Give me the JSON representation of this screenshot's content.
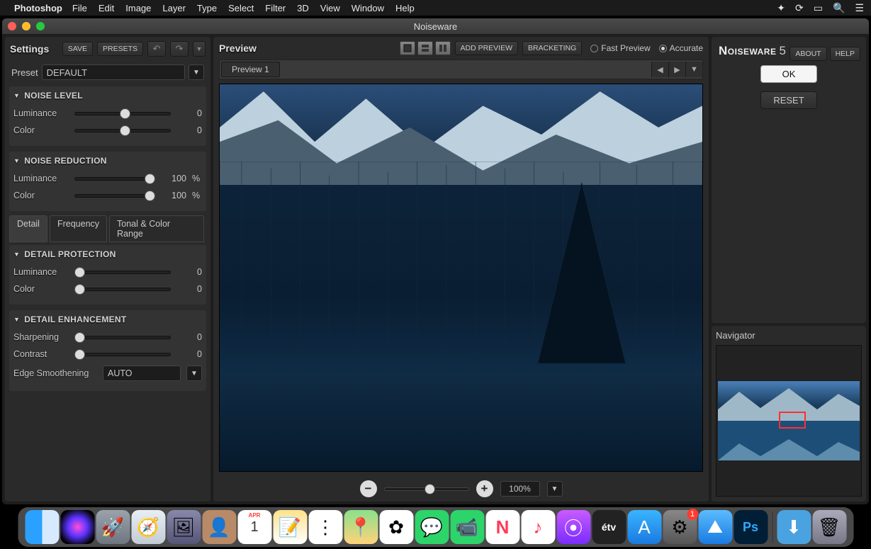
{
  "menubar": {
    "app": "Photoshop",
    "items": [
      "File",
      "Edit",
      "Image",
      "Layer",
      "Type",
      "Select",
      "Filter",
      "3D",
      "View",
      "Window",
      "Help"
    ]
  },
  "window_title": "Noiseware",
  "settings": {
    "title": "Settings",
    "save_btn": "SAVE",
    "presets_btn": "PRESETS",
    "preset_label": "Preset",
    "preset_value": "DEFAULT",
    "noise_level": {
      "title": "NOISE LEVEL",
      "luminance_label": "Luminance",
      "luminance_val": "0",
      "color_label": "Color",
      "color_val": "0"
    },
    "noise_reduction": {
      "title": "NOISE REDUCTION",
      "luminance_label": "Luminance",
      "luminance_val": "100",
      "luminance_unit": "%",
      "color_label": "Color",
      "color_val": "100",
      "color_unit": "%"
    },
    "tabs": {
      "detail": "Detail",
      "frequency": "Frequency",
      "tonal": "Tonal & Color Range"
    },
    "detail_protection": {
      "title": "DETAIL PROTECTION",
      "luminance_label": "Luminance",
      "luminance_val": "0",
      "color_label": "Color",
      "color_val": "0"
    },
    "detail_enhancement": {
      "title": "DETAIL ENHANCEMENT",
      "sharpening_label": "Sharpening",
      "sharpening_val": "0",
      "contrast_label": "Contrast",
      "contrast_val": "0",
      "edge_label": "Edge Smoothening",
      "edge_value": "AUTO"
    }
  },
  "preview": {
    "title": "Preview",
    "add_preview_btn": "ADD PREVIEW",
    "bracketing_btn": "BRACKETING",
    "mode_fast": "Fast Preview",
    "mode_accurate": "Accurate",
    "tab1": "Preview 1",
    "zoom_value": "100%"
  },
  "right": {
    "brand": "Noiseware",
    "version": "5",
    "about_btn": "ABOUT",
    "help_btn": "HELP",
    "ok_btn": "OK",
    "reset_btn": "RESET",
    "navigator_title": "Navigator"
  },
  "dock": {
    "calendar_month": "APR",
    "calendar_day": "1",
    "tv_label": "étv",
    "ps_label": "Ps",
    "settings_badge": "1"
  }
}
